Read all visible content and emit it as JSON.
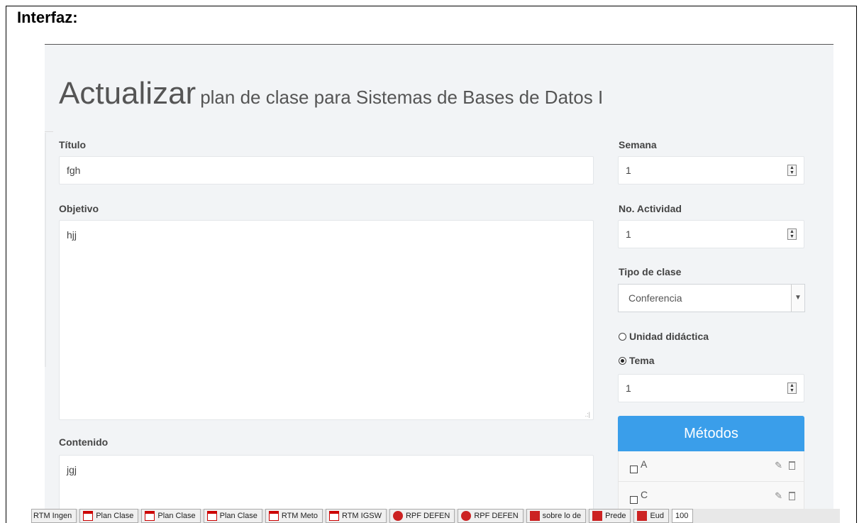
{
  "doc_heading": "Interfaz:",
  "page": {
    "title_big": "Actualizar",
    "title_small": "plan de clase para Sistemas de Bases de Datos I"
  },
  "form": {
    "titulo_label": "Título",
    "titulo_value": "fgh",
    "objetivo_label": "Objetivo",
    "objetivo_value": "hjj",
    "contenido_label": "Contenido",
    "contenido_value": "jgj",
    "semana_label": "Semana",
    "semana_value": "1",
    "actividad_label": "No. Actividad",
    "actividad_value": "1",
    "tipo_label": "Tipo de clase",
    "tipo_value": "Conferencia",
    "unidad_label": "Unidad didáctica",
    "tema_label": "Tema",
    "tema_value": "1"
  },
  "metodos": {
    "title": "Métodos",
    "items": [
      {
        "label": "A"
      },
      {
        "label": "C"
      }
    ]
  },
  "taskbar": {
    "items": [
      {
        "label": "RTM Ingen",
        "icon": "pdf-icon"
      },
      {
        "label": "Plan Clase",
        "icon": "pdf-icon"
      },
      {
        "label": "Plan Clase",
        "icon": "pdf-icon"
      },
      {
        "label": "Plan Clase",
        "icon": "pdf-icon"
      },
      {
        "label": "RTM Meto",
        "icon": "pdf-icon"
      },
      {
        "label": "RTM IGSW",
        "icon": "pdf-icon"
      },
      {
        "label": "RPF DEFEN",
        "icon": "error-icon"
      },
      {
        "label": "RPF DEFEN",
        "icon": "error-icon"
      },
      {
        "label": "sobre lo de",
        "icon": "book-icon"
      },
      {
        "label": "Prede",
        "icon": "book-icon"
      },
      {
        "label": "Eud",
        "icon": "book-icon"
      },
      {
        "label": "100",
        "icon": ""
      }
    ]
  },
  "colors": {
    "accent": "#3a9eea",
    "background": "#f2f4f6"
  }
}
